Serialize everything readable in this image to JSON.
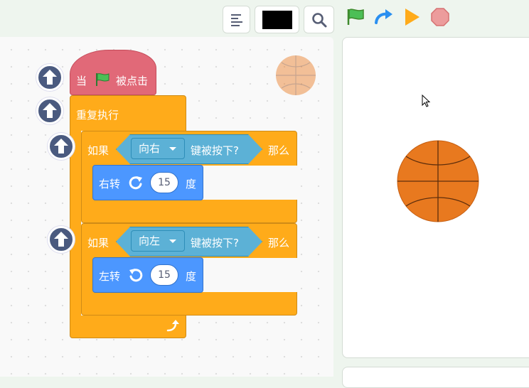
{
  "toolbar": {
    "buttons": [
      {
        "name": "align-left-icon"
      },
      {
        "name": "color-swatch",
        "color": "#000000"
      },
      {
        "name": "search-icon"
      }
    ],
    "controls": [
      "green-flag-icon",
      "redo-icon",
      "play-icon",
      "stop-icon"
    ]
  },
  "script": {
    "hat": {
      "prefix": "当",
      "suffix": "被点击",
      "icon": "green-flag-icon",
      "color": "#e16978"
    },
    "forever": {
      "label": "重复执行",
      "color": "#ffab1a"
    },
    "if_blocks": [
      {
        "if_label": "如果",
        "key": "向右",
        "sensing_label": "键被按下?",
        "then_label": "那么",
        "action": {
          "label": "右转",
          "icon": "rotate-clockwise-icon",
          "value": "15",
          "unit": "度"
        }
      },
      {
        "if_label": "如果",
        "key": "向左",
        "sensing_label": "键被按下?",
        "then_label": "那么",
        "action": {
          "label": "左转",
          "icon": "rotate-counterclockwise-icon",
          "value": "15",
          "unit": "度"
        }
      }
    ]
  },
  "sprite": {
    "name": "basketball",
    "color": "#e8791f"
  },
  "colors": {
    "motion": "#4c97ff",
    "sensing": "#5cb1d6",
    "control": "#ffab1a",
    "events": "#e16978"
  }
}
